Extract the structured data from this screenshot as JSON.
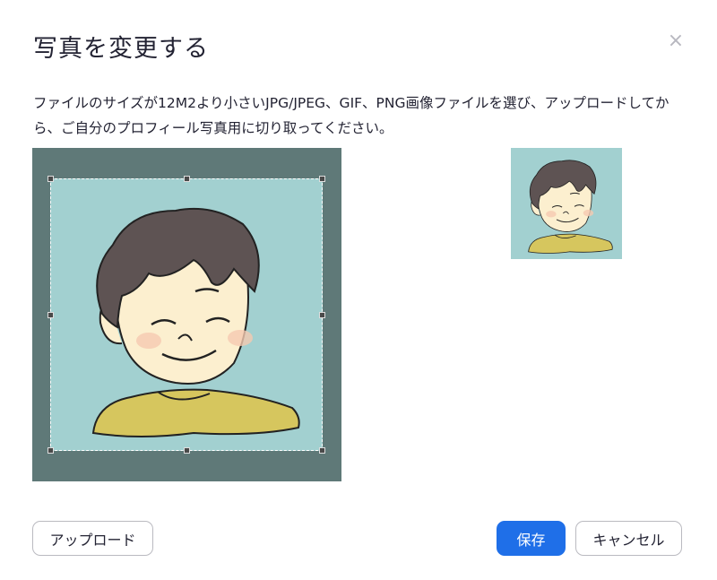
{
  "dialog": {
    "title": "写真を変更する",
    "close_symbol": "×",
    "description": "ファイルのサイズが12M2より小さいJPG/JPEG、GIF、PNG画像ファイルを選び、アップロードしてから、ご自分のプロフィール写真用に切り取ってください。"
  },
  "buttons": {
    "upload_label": "アップロード",
    "save_label": "保存",
    "cancel_label": "キャンセル"
  },
  "icons": {
    "close": "close-icon"
  },
  "colors": {
    "accent": "#1f6fe8",
    "crop_background": "#5f7978",
    "photo_background": "#a2d0d0",
    "hair": "#5e5353",
    "skin": "#fcefcf",
    "shirt": "#d6c65e"
  }
}
